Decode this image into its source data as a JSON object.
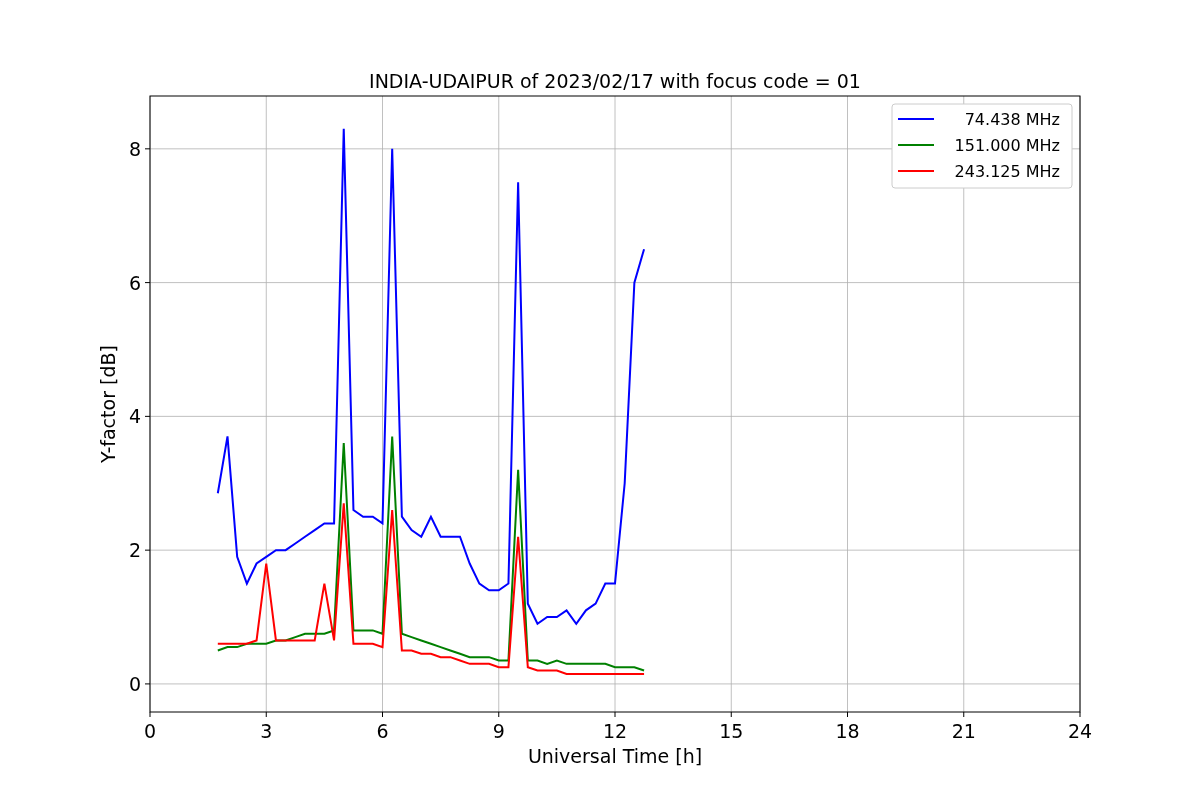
{
  "figure": {
    "chart_data": {
      "type": "line",
      "title": "INDIA-UDAIPUR of 2023/02/17 with focus code = 01",
      "xlabel": "Universal Time [h]",
      "ylabel": "Y-factor [dB]",
      "x": [
        1.75,
        2.0,
        2.25,
        2.5,
        2.75,
        3.0,
        3.25,
        3.5,
        3.75,
        4.0,
        4.25,
        4.5,
        4.75,
        5.0,
        5.25,
        5.5,
        5.75,
        6.0,
        6.25,
        6.5,
        6.75,
        7.0,
        7.25,
        7.5,
        7.75,
        8.0,
        8.25,
        8.5,
        8.75,
        9.0,
        9.25,
        9.5,
        9.75,
        10.0,
        10.25,
        10.5,
        10.75,
        11.0,
        11.25,
        11.5,
        11.75,
        12.0,
        12.25,
        12.5,
        12.75
      ],
      "series": [
        {
          "name": "74.438 MHz",
          "color": "#0000ff",
          "values": [
            2.85,
            3.7,
            1.9,
            1.5,
            1.8,
            1.9,
            2.0,
            2.0,
            2.1,
            2.2,
            2.3,
            2.4,
            2.4,
            8.3,
            2.6,
            2.5,
            2.5,
            2.4,
            8.0,
            2.5,
            2.3,
            2.2,
            2.5,
            2.2,
            2.2,
            2.2,
            1.8,
            1.5,
            1.4,
            1.4,
            1.5,
            7.5,
            1.2,
            0.9,
            1.0,
            1.0,
            1.1,
            0.9,
            1.1,
            1.2,
            1.5,
            1.5,
            3.0,
            6.0,
            6.5
          ]
        },
        {
          "name": "151.000 MHz",
          "color": "#008000",
          "values": [
            0.5,
            0.55,
            0.55,
            0.6,
            0.6,
            0.6,
            0.65,
            0.65,
            0.7,
            0.75,
            0.75,
            0.75,
            0.8,
            3.6,
            0.8,
            0.8,
            0.8,
            0.75,
            3.7,
            0.75,
            0.7,
            0.65,
            0.6,
            0.55,
            0.5,
            0.45,
            0.4,
            0.4,
            0.4,
            0.35,
            0.35,
            3.2,
            0.35,
            0.35,
            0.3,
            0.35,
            0.3,
            0.3,
            0.3,
            0.3,
            0.3,
            0.25,
            0.25,
            0.25,
            0.2
          ]
        },
        {
          "name": "243.125 MHz",
          "color": "#ff0000",
          "values": [
            0.6,
            0.6,
            0.6,
            0.6,
            0.65,
            1.8,
            0.65,
            0.65,
            0.65,
            0.65,
            0.65,
            1.5,
            0.65,
            2.7,
            0.6,
            0.6,
            0.6,
            0.55,
            2.6,
            0.5,
            0.5,
            0.45,
            0.45,
            0.4,
            0.4,
            0.35,
            0.3,
            0.3,
            0.3,
            0.25,
            0.25,
            2.2,
            0.25,
            0.2,
            0.2,
            0.2,
            0.15,
            0.15,
            0.15,
            0.15,
            0.15,
            0.15,
            0.15,
            0.15,
            0.15
          ]
        }
      ],
      "grid": true,
      "legend": true,
      "xlim": [
        0,
        24
      ],
      "ylim": [
        -0.42,
        8.79
      ],
      "xticks": [
        0,
        3,
        6,
        9,
        12,
        15,
        18,
        21,
        24
      ],
      "yticks": [
        0,
        2,
        4,
        6,
        8
      ]
    }
  }
}
